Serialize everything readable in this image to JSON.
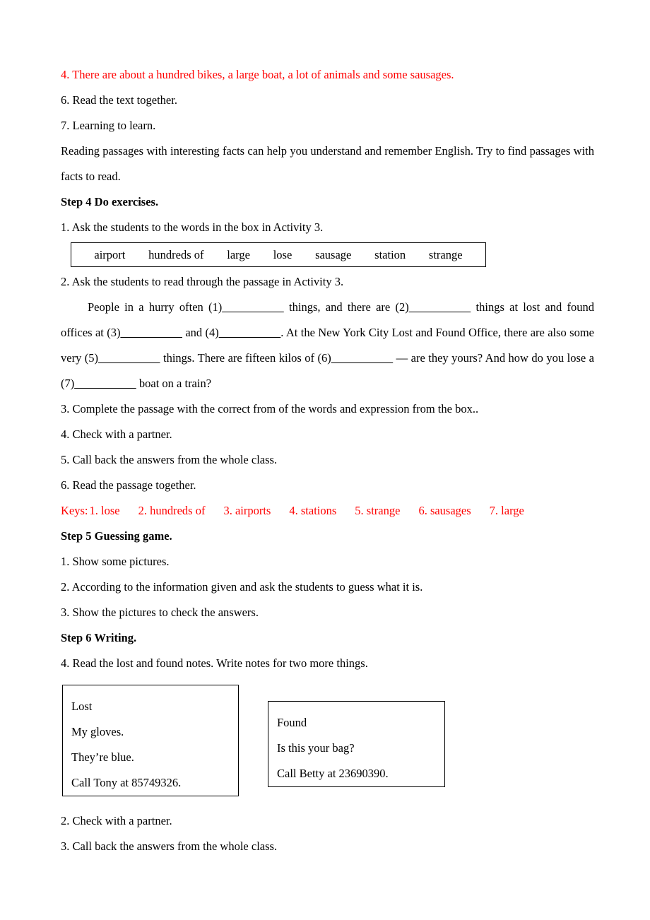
{
  "colors": {
    "answer_red": "#ff0000",
    "text_black": "#000000",
    "border": "#000000"
  },
  "top_notes": {
    "item4_answer": "4. There are about a hundred bikes, a large boat, a lot of animals and some sausages.",
    "item6": "6. Read the text together.",
    "item7": "7. Learning to learn.",
    "learning_tip": "Reading passages with interesting facts can help you understand and remember English. Try to find passages with facts to read."
  },
  "step4": {
    "heading": "Step 4 Do exercises.",
    "item1": "1. Ask the students to the words in the box in Activity 3.",
    "word_bank": [
      "airport",
      "hundreds of",
      "large",
      "lose",
      "sausage",
      "station",
      "strange"
    ],
    "item2": "2. Ask the students to read through the passage in Activity 3.",
    "passage": {
      "seg1": "People in a hurry often (1)",
      "b1": "__________",
      "seg2": " things, and there are (2)",
      "b2": "__________",
      "seg3": " things at lost and found offices at (3)",
      "b3": "__________",
      "seg4": " and (4)",
      "b4": "__________",
      "seg5": ". At the New York City Lost and Found Office, there are also some very (5)",
      "b5": "__________",
      "seg6": " things. There are fifteen kilos of (6)",
      "b6": "__________",
      "seg7": " — are they yours? And how do you lose a (7)",
      "b7": "__________",
      "seg8": " boat on a train?"
    },
    "item3": "3. Complete the passage with the correct from of the words and expression from the box..",
    "item4": "4. Check with a partner.",
    "item5": "5. Call back the answers from the whole class.",
    "item6": "6. Read the passage together.",
    "keys_label": "Keys:",
    "keys": [
      "1. lose",
      "2. hundreds of",
      "3. airports",
      "4. stations",
      "5. strange",
      "6. sausages",
      "7. large"
    ]
  },
  "step5": {
    "heading": "Step 5 Guessing game.",
    "item1": "1. Show some pictures.",
    "item2": "2. According to the information given and ask the students to guess what it is.",
    "item3": "3. Show the pictures to check the answers."
  },
  "step6": {
    "heading": "Step 6 Writing.",
    "item4": "4. Read the lost and found notes. Write notes for two more things.",
    "lost_note": {
      "title": "Lost",
      "line1": "My gloves.",
      "line2": "They’re blue.",
      "line3": "Call Tony at 85749326."
    },
    "found_note": {
      "title": "Found",
      "line1": "Is this your bag?",
      "line2": "Call Betty at 23690390."
    },
    "item2": "2. Check with a partner.",
    "item3": "3. Call back the answers from the whole class."
  }
}
